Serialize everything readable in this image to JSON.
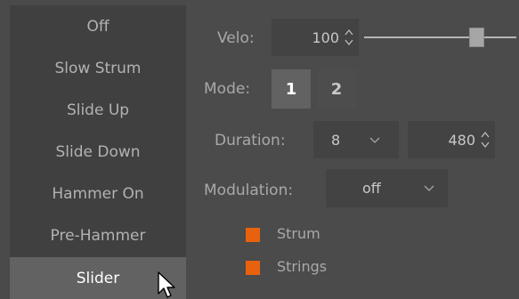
{
  "list": {
    "items": [
      "Off",
      "Slow Strum",
      "Slide Up",
      "Slide Down",
      "Hammer On",
      "Pre-Hammer",
      "Slider"
    ],
    "selected": "Slider"
  },
  "velo": {
    "label": "Velo:",
    "value": "100",
    "slider_level": 0.75
  },
  "mode": {
    "label": "Mode:",
    "options": [
      "1",
      "2"
    ],
    "selected": "1"
  },
  "duration": {
    "label": "Duration:",
    "dropdown_value": "8",
    "ticks_value": "480"
  },
  "modulation": {
    "label": "Modulation:",
    "value": "off"
  },
  "options": [
    {
      "label": "Strum",
      "checked": true
    },
    {
      "label": "Strings",
      "checked": true
    }
  ],
  "colors": {
    "accent": "#e8620e",
    "selected_bg": "#626262"
  }
}
